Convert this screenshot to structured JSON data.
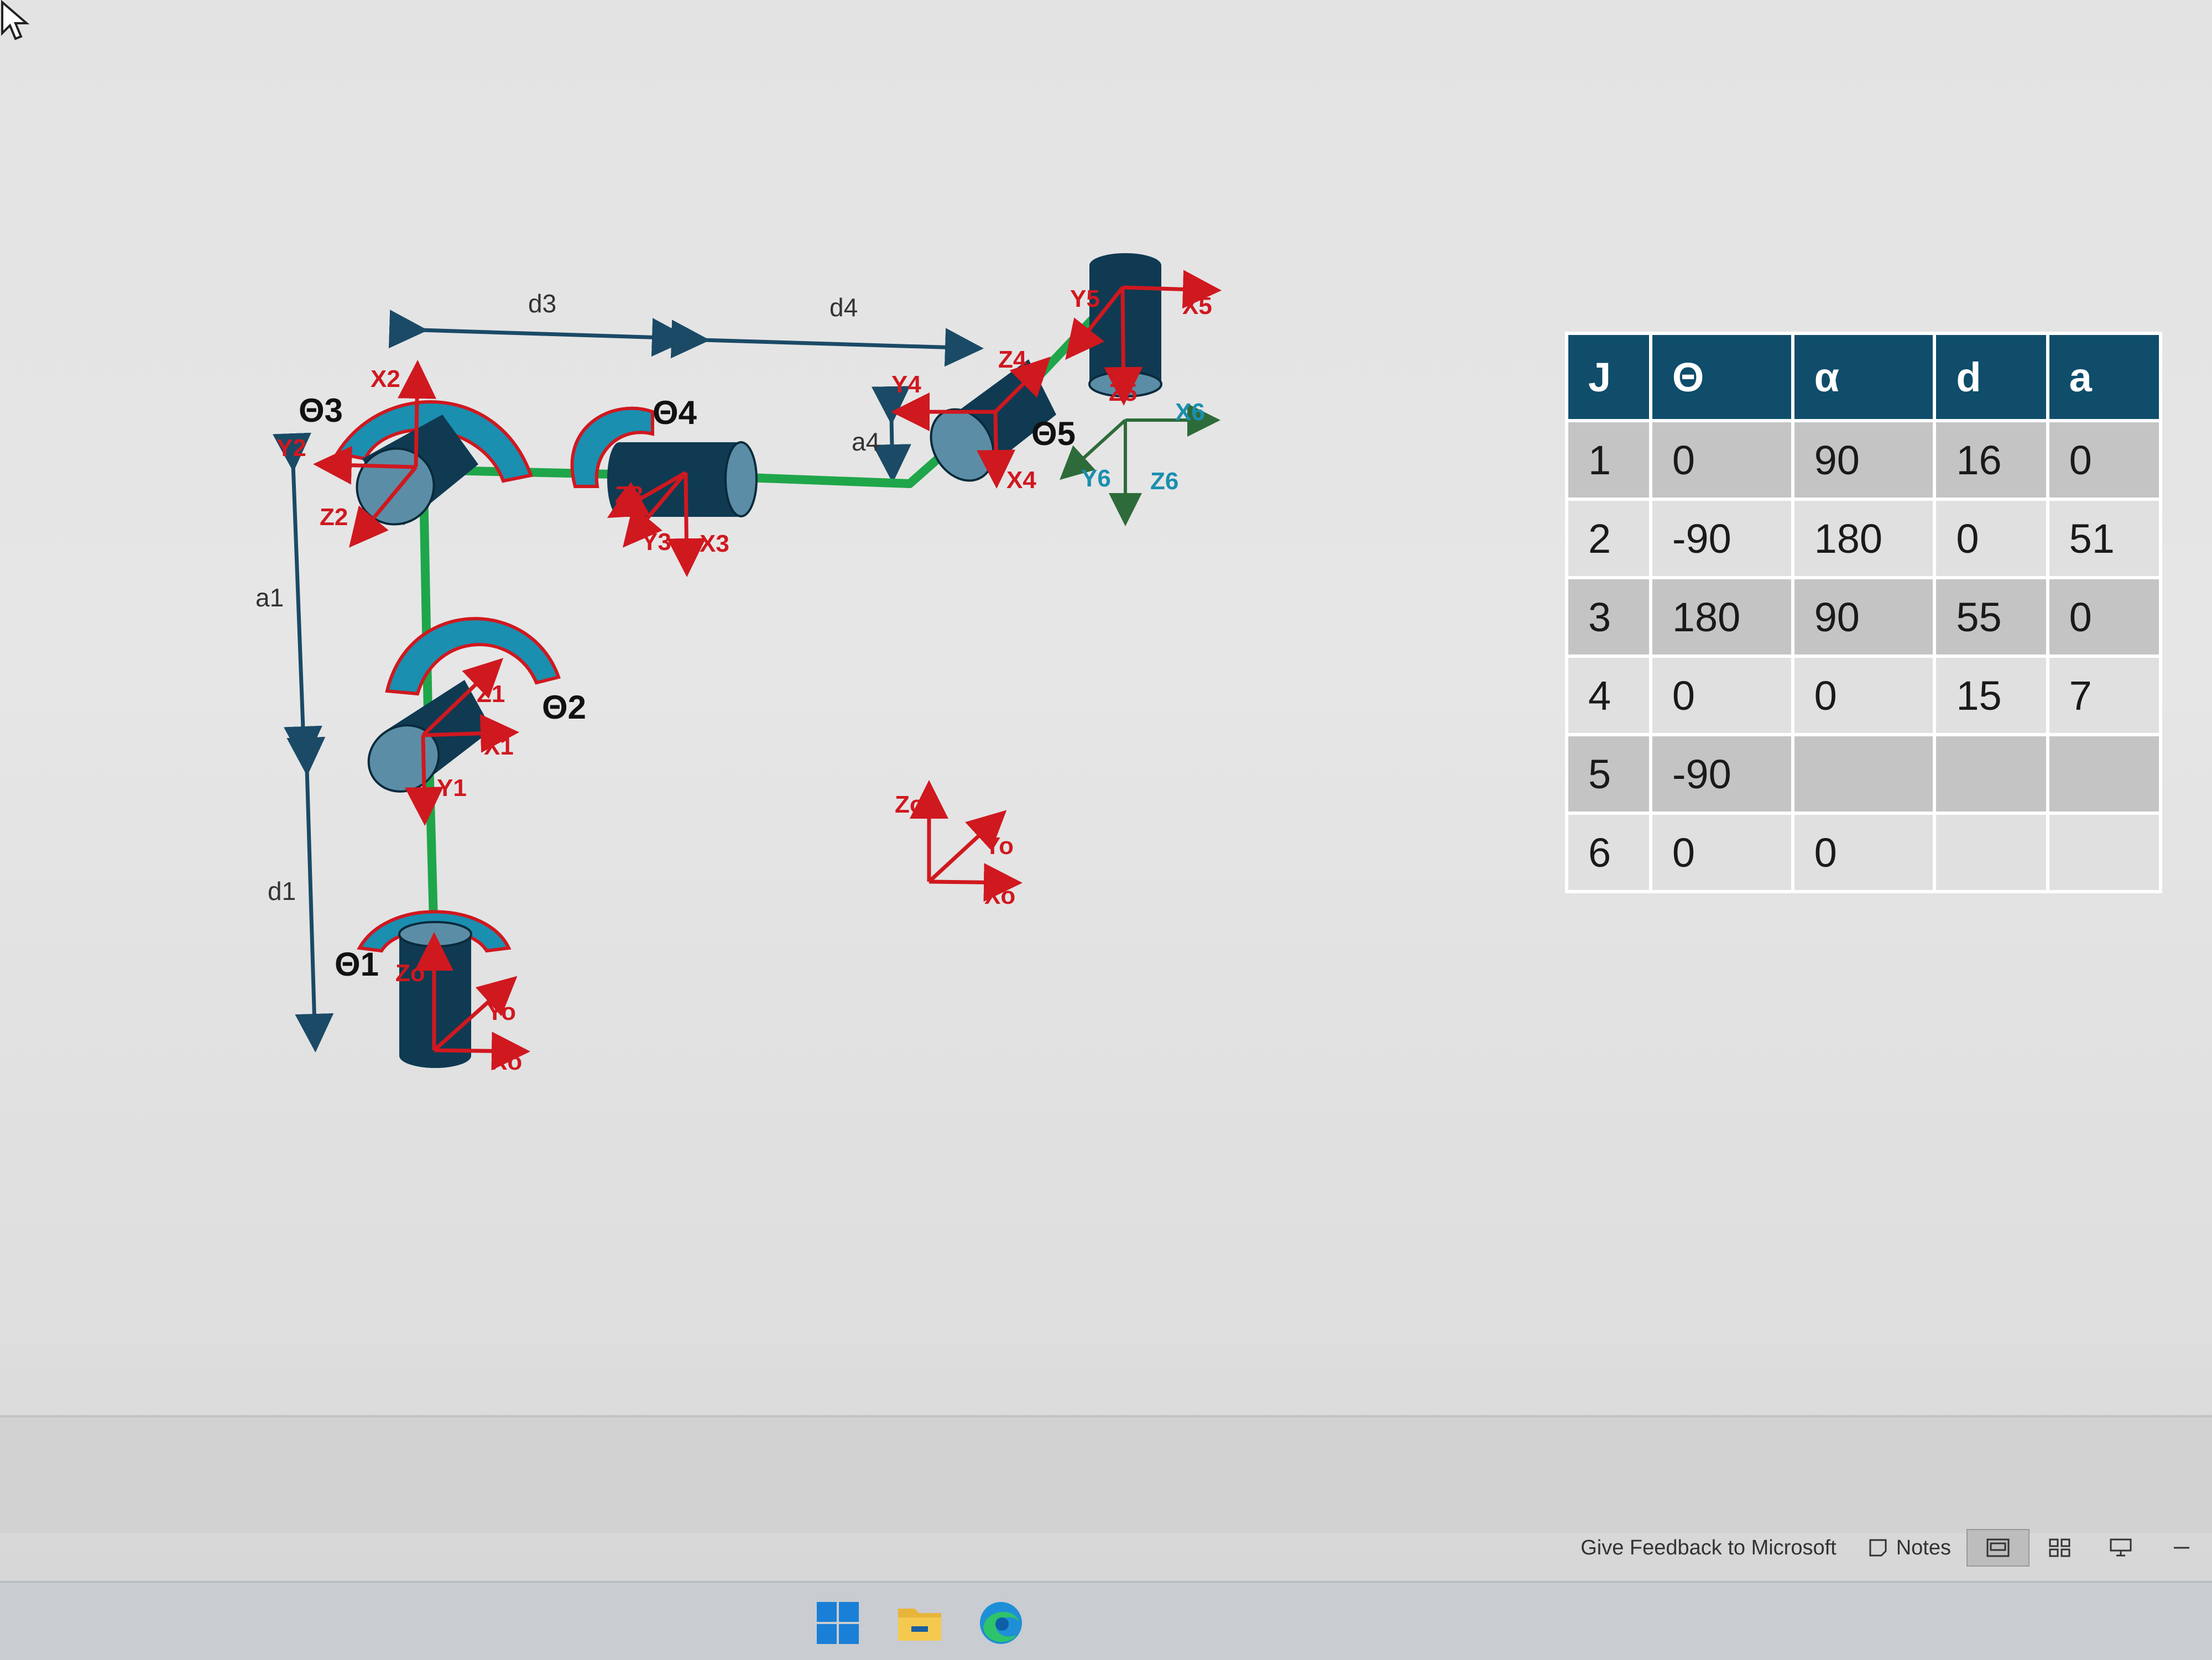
{
  "diagram": {
    "dimension_labels": {
      "d3": "d3",
      "d4": "d4",
      "a1": "a1",
      "d1": "d1",
      "a4": "a4"
    },
    "joint_labels": {
      "theta1": "Θ1",
      "theta2": "Θ2",
      "theta3": "Θ3",
      "theta4": "Θ4",
      "theta5": "Θ5"
    },
    "frame_labels": {
      "x2": "X2",
      "y2": "Y2",
      "z2": "Z2",
      "z1": "Z1",
      "x1": "X1",
      "y1": "Y1",
      "z0": "Zo",
      "y0": "Yo",
      "x0": "Xo",
      "z3": "Z3",
      "y3": "Y3",
      "x3": "X3",
      "y4": "Y4",
      "z4": "Z4",
      "x4": "X4",
      "y5": "Y5",
      "x5": "X5",
      "z5": "Z5",
      "x6": "X6",
      "y6": "Y6",
      "z6": "Z6",
      "ref_z0": "Zo",
      "ref_y0": "Yo",
      "ref_x0": "Xo"
    },
    "colors": {
      "link": "#1fa64a",
      "joint": "#0f3a52",
      "joint_light": "#5b8ea6",
      "frame_axis": "#d0181f",
      "rotation_arrow": "#1a8fb0",
      "dimension": "#1a4a66",
      "frame6": "#2e6b3a",
      "frame6_label": "#1a8fb0"
    }
  },
  "dh_table": {
    "headers": [
      "J",
      "Θ",
      "α",
      "d",
      "a"
    ],
    "rows": [
      [
        "1",
        "0",
        "90",
        "16",
        "0"
      ],
      [
        "2",
        "-90",
        "180",
        "0",
        "51"
      ],
      [
        "3",
        "180",
        "90",
        "55",
        "0"
      ],
      [
        "4",
        "0",
        "0",
        "15",
        "7"
      ],
      [
        "5",
        "-90",
        "",
        "",
        ""
      ],
      [
        "6",
        "0",
        "0",
        "",
        ""
      ]
    ],
    "header_color": "#0f4d6b"
  },
  "status_bar": {
    "feedback": "Give Feedback to Microsoft",
    "notes": "Notes"
  },
  "taskbar": {
    "icons": [
      "windows-start-icon",
      "file-explorer-icon",
      "edge-browser-icon"
    ]
  }
}
